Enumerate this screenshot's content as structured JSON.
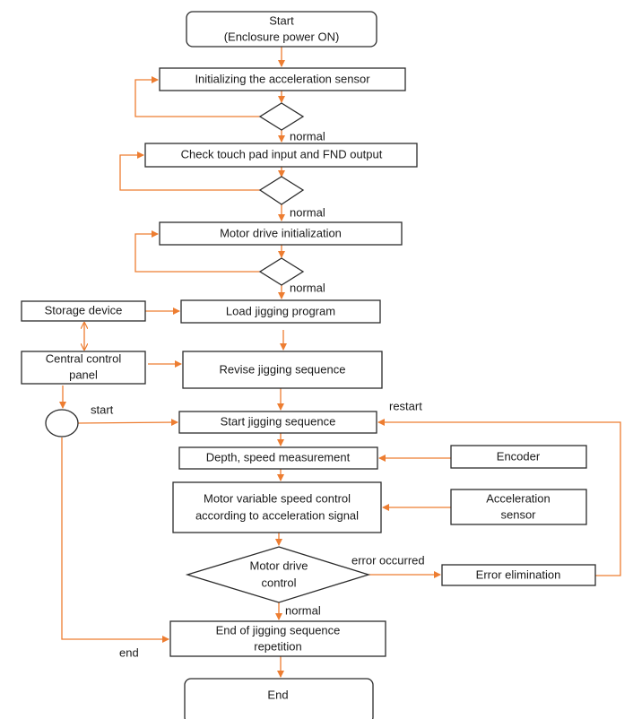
{
  "diagram": {
    "type": "flowchart",
    "colors": {
      "connector": "#ed7d31",
      "border": "#2b2b2b",
      "text": "#1a1a1a"
    },
    "nodes": {
      "start": {
        "shape": "rounded-rect",
        "lines": [
          "Start",
          "(Enclosure power ON)"
        ]
      },
      "init_accel": {
        "shape": "rect",
        "lines": [
          "Initializing the acceleration sensor"
        ]
      },
      "check1": {
        "shape": "diamond",
        "lines": []
      },
      "check_touch": {
        "shape": "rect",
        "lines": [
          "Check touch pad input and FND output"
        ]
      },
      "check2": {
        "shape": "diamond",
        "lines": []
      },
      "motor_init": {
        "shape": "rect",
        "lines": [
          "Motor drive initialization"
        ]
      },
      "check3": {
        "shape": "diamond",
        "lines": []
      },
      "storage": {
        "shape": "rect",
        "lines": [
          "Storage device"
        ]
      },
      "load": {
        "shape": "rect",
        "lines": [
          "Load jigging program"
        ]
      },
      "central": {
        "shape": "rect",
        "lines": [
          "Central control",
          "panel"
        ]
      },
      "revise": {
        "shape": "rect",
        "lines": [
          "Revise jigging sequence"
        ]
      },
      "switch": {
        "shape": "circle",
        "lines": []
      },
      "start_seq": {
        "shape": "rect",
        "lines": [
          "Start jigging sequence"
        ]
      },
      "depth": {
        "shape": "rect",
        "lines": [
          "Depth, speed measurement"
        ]
      },
      "encoder": {
        "shape": "rect",
        "lines": [
          "Encoder"
        ]
      },
      "motor_var": {
        "shape": "rect",
        "lines": [
          "Motor variable speed control",
          "according to acceleration signal"
        ]
      },
      "accel_sensor": {
        "shape": "rect",
        "lines": [
          "Acceleration",
          "sensor"
        ]
      },
      "motor_ctrl": {
        "shape": "diamond",
        "lines": [
          "Motor drive",
          "control"
        ]
      },
      "error_elim": {
        "shape": "rect",
        "lines": [
          "Error elimination"
        ]
      },
      "end_rep": {
        "shape": "rect",
        "lines": [
          "End of jigging sequence",
          "repetition"
        ]
      },
      "end": {
        "shape": "rounded-rect",
        "lines": [
          "End"
        ]
      }
    },
    "edges": [
      {
        "from": "start",
        "to": "init_accel",
        "label": ""
      },
      {
        "from": "init_accel",
        "to": "check1",
        "label": ""
      },
      {
        "from": "check1",
        "to": "init_accel",
        "label": ""
      },
      {
        "from": "check1",
        "to": "check_touch",
        "label": "normal"
      },
      {
        "from": "check_touch",
        "to": "check2",
        "label": ""
      },
      {
        "from": "check2",
        "to": "check_touch",
        "label": ""
      },
      {
        "from": "check2",
        "to": "motor_init",
        "label": "normal"
      },
      {
        "from": "motor_init",
        "to": "check3",
        "label": ""
      },
      {
        "from": "check3",
        "to": "motor_init",
        "label": ""
      },
      {
        "from": "check3",
        "to": "load",
        "label": "normal"
      },
      {
        "from": "storage",
        "to": "load",
        "label": ""
      },
      {
        "from": "storage",
        "to": "central",
        "label": "",
        "bidirectional": true
      },
      {
        "from": "load",
        "to": "revise",
        "label": ""
      },
      {
        "from": "central",
        "to": "revise",
        "label": ""
      },
      {
        "from": "central",
        "to": "switch",
        "label": ""
      },
      {
        "from": "switch",
        "to": "start_seq",
        "label": "start"
      },
      {
        "from": "revise",
        "to": "start_seq",
        "label": ""
      },
      {
        "from": "start_seq",
        "to": "depth",
        "label": ""
      },
      {
        "from": "encoder",
        "to": "depth",
        "label": ""
      },
      {
        "from": "depth",
        "to": "motor_var",
        "label": ""
      },
      {
        "from": "accel_sensor",
        "to": "motor_var",
        "label": ""
      },
      {
        "from": "motor_var",
        "to": "motor_ctrl",
        "label": ""
      },
      {
        "from": "motor_ctrl",
        "to": "error_elim",
        "label": "error occurred"
      },
      {
        "from": "error_elim",
        "to": "start_seq",
        "label": "restart"
      },
      {
        "from": "motor_ctrl",
        "to": "end_rep",
        "label": "normal"
      },
      {
        "from": "switch",
        "to": "end_rep",
        "label": "end"
      },
      {
        "from": "end_rep",
        "to": "end",
        "label": ""
      }
    ]
  }
}
